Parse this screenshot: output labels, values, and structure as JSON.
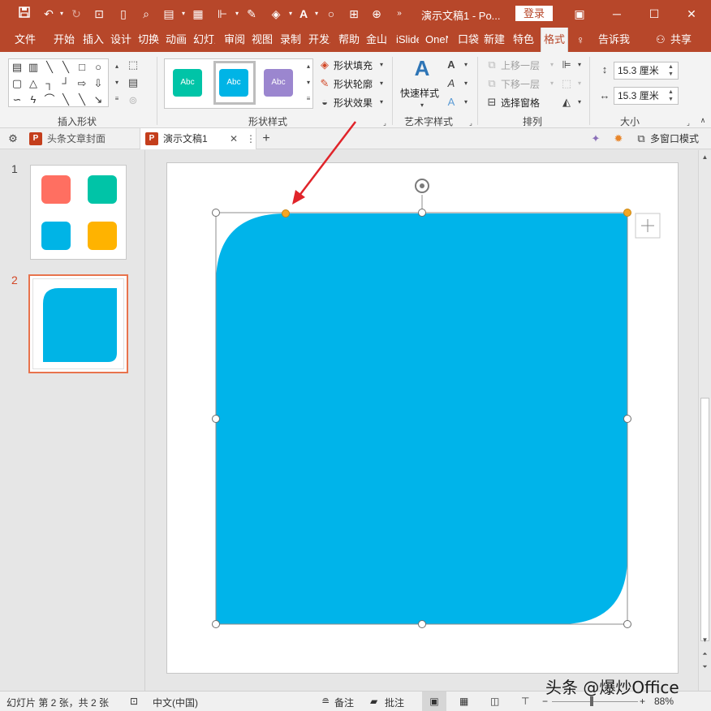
{
  "window": {
    "title": "演示文稿1 - Po...",
    "login_label": "登录",
    "accent_color": "#b7472a"
  },
  "ribbon_tabs": [
    "文件",
    "开始",
    "插入",
    "设计",
    "切换",
    "动画",
    "幻灯片",
    "审阅",
    "视图",
    "录制",
    "开发工具",
    "帮助",
    "金山",
    "iSlide",
    "OneNote",
    "口袋",
    "新建",
    "特色",
    "格式",
    "告诉我",
    "共享"
  ],
  "ribbon": {
    "groups": {
      "insert_shapes": "插入形状",
      "shape_styles": "形状样式",
      "art_text": "艺术字样式",
      "arrange": "排列",
      "size": "大小"
    },
    "style_swatches": [
      {
        "label": "Abc",
        "color": "#00c4a7"
      },
      {
        "label": "Abc",
        "color": "#00b4e6"
      },
      {
        "label": "Abc",
        "color": "#9b86cf"
      }
    ],
    "shape_fill": "形状填充",
    "shape_outline": "形状轮廓",
    "shape_effects": "形状效果",
    "quick_styles": "快速样式",
    "bring_forward": "上移一层",
    "send_backward": "下移一层",
    "selection_pane": "选择窗格",
    "height_value": "15.3 厘米",
    "width_value": "15.3 厘米"
  },
  "doc_tabs": [
    {
      "label": "头条文章封面"
    },
    {
      "label": "演示文稿1"
    }
  ],
  "multi_window": "多窗口模式",
  "thumbnails": [
    {
      "number": "1",
      "colors": [
        "#ff6f61",
        "#00c4a7",
        "#00b4e6",
        "#ffb300"
      ]
    },
    {
      "number": "2",
      "colors": [
        "#00b4e6"
      ]
    }
  ],
  "slide": {
    "shape_color": "#00b4ea",
    "adjust_handle_color": "#f5a623",
    "arrow_color": "#e0242a"
  },
  "status": {
    "slide_info": "幻灯片 第 2 张，共 2 张",
    "language": "中文(中国)",
    "notes": "备注",
    "comments": "批注",
    "zoom": "88%"
  },
  "watermark": "头条 @爆炒Office"
}
